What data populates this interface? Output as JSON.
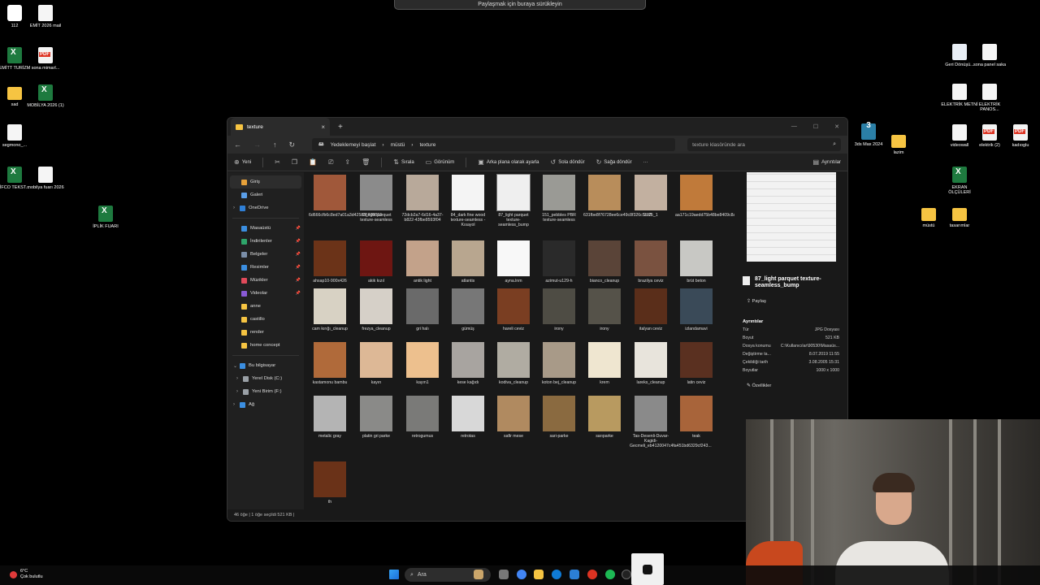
{
  "share_bar": "Paylaşmak için buraya sürükleyin",
  "desktop_left": [
    {
      "label": "112",
      "kind": "cube"
    },
    {
      "label": "EMİT 2026 mail",
      "kind": "doc"
    },
    {
      "label": "EMİTT TURİZM",
      "kind": "xls"
    },
    {
      "label": "sona mimarl...",
      "kind": "pdf"
    },
    {
      "label": "sad",
      "kind": "folder"
    },
    {
      "label": "MOBİLYA 2026 (1)",
      "kind": "xls"
    },
    {
      "label": "segmono_...",
      "kind": "doc"
    },
    {
      "label": "İFCO TEKST...",
      "kind": "xls"
    },
    {
      "label": "mobilya fuarı 2026",
      "kind": "doc"
    },
    {
      "label": "İPLİK FUARI",
      "kind": "xls"
    }
  ],
  "desktop_right": [
    {
      "label": "Geri Dönüşü...",
      "kind": "recycle"
    },
    {
      "label": "sona panel saka",
      "kind": "doc"
    },
    {
      "label": "ELEKTRİK METNİ",
      "kind": "doc"
    },
    {
      "label": "ELEKTRİK PANOS...",
      "kind": "doc"
    },
    {
      "label": "3ds Max 2024",
      "kind": "max"
    },
    {
      "label": "lazim",
      "kind": "folder"
    },
    {
      "label": "videowall",
      "kind": "doc"
    },
    {
      "label": "elektrik (2)",
      "kind": "pdf"
    },
    {
      "label": "kadıoglu",
      "kind": "pdf"
    },
    {
      "label": "EKRAN ÖLÇÜLERİ",
      "kind": "xls"
    },
    {
      "label": "müstü",
      "kind": "folder"
    },
    {
      "label": "tasarımlar",
      "kind": "folder"
    }
  ],
  "window": {
    "tab_title": "texture",
    "address": {
      "segments": [
        "Yedeklemeyi başlat",
        "müstü",
        "texture"
      ]
    },
    "search_placeholder": "texture klasöründe ara",
    "toolbar": {
      "new": "Yeni",
      "sort": "Sırala",
      "view": "Görünüm",
      "set_background": "Arka plana olarak ayarla",
      "rotate_left": "Sola döndür",
      "rotate_right": "Sağa döndür",
      "more": "···",
      "details": "Ayrıntılar"
    },
    "nav": {
      "top": [
        "Giriş",
        "Galeri",
        "OneDrive"
      ],
      "pinned": [
        "Masaüstü",
        "İndirilenler",
        "Belgeler",
        "Resimler",
        "Müzikler",
        "Videolar"
      ],
      "folders": [
        "anne",
        "castillo",
        "render",
        "home concept"
      ],
      "pc": [
        "Bu bilgisayar",
        "Yerel Disk (C:)",
        "Yeni Birim (F:)",
        "Ağ"
      ]
    },
    "files": [
      {
        "name": "6d666cfb6c8ed7a01a3d425c36409319",
        "color": "#a0583a"
      },
      {
        "name": "38_light parquet texture-seamless",
        "color": "#8b8b8b"
      },
      {
        "name": "72dcb2a7-6d16-4a37-b822-43fbe8593f04",
        "color": "#b8a99a"
      },
      {
        "name": "84_dark fine wood texture-seamless - Kısayol",
        "color": "#f4f4f4"
      },
      {
        "name": "87_light parquet texture-seamless_bump",
        "color": "#efefef"
      },
      {
        "name": "151_pebbles PBR texture-seamless",
        "color": "#9a9a95"
      },
      {
        "name": "631fbe8f76728ee6ce49c8f326c5cd3",
        "color": "#b88d5b"
      },
      {
        "name": "2175_1",
        "color": "#c2b0a0"
      },
      {
        "name": "aa171c19aedd75b48be8409c8a83eb1a",
        "color": "#c07a3a"
      },
      {
        "name": "ahsap10-900x426",
        "color": "#6b3318"
      },
      {
        "name": "akik kızıl",
        "color": "#6e1612"
      },
      {
        "name": "antik light",
        "color": "#c3a28a"
      },
      {
        "name": "atlantis",
        "color": "#b8a68f"
      },
      {
        "name": "ayna.lnm",
        "color": "#f8f8f8"
      },
      {
        "name": "azimut-u129-h",
        "color": "#2a2a2a"
      },
      {
        "name": "bianco_cleanup",
        "color": "#5a4438"
      },
      {
        "name": "brazilya ceviz",
        "color": "#7a5240"
      },
      {
        "name": "brüt beton",
        "color": "#c8c8c4"
      },
      {
        "name": "cam kırığı_cleanup",
        "color": "#d8d2c4"
      },
      {
        "name": "frezya_cleanup",
        "color": "#d6d0c8"
      },
      {
        "name": "gri halı",
        "color": "#6a6a6a"
      },
      {
        "name": "gümüş",
        "color": "#777"
      },
      {
        "name": "hareli ceviz",
        "color": "#7a3e22"
      },
      {
        "name": "irony",
        "color": "#4e4c44"
      },
      {
        "name": "irony",
        "color": "#555249"
      },
      {
        "name": "italyan ceviz",
        "color": "#5a2e1a"
      },
      {
        "name": "izlandamavi",
        "color": "#3a4a58"
      },
      {
        "name": "kastamonu bambu",
        "color": "#b06a3a"
      },
      {
        "name": "kayın",
        "color": "#ddb896"
      },
      {
        "name": "kayın1",
        "color": "#edc08e"
      },
      {
        "name": "kese kağıdı",
        "color": "#a8a4a0"
      },
      {
        "name": "kodiva_cleanup",
        "color": "#b0aca2"
      },
      {
        "name": "koton bej_cleanup",
        "color": "#a89a88"
      },
      {
        "name": "krem",
        "color": "#efe6d0"
      },
      {
        "name": "lareks_cleanup",
        "color": "#e8e4dc"
      },
      {
        "name": "latin ceviz",
        "color": "#5a3020"
      },
      {
        "name": "metalic gray",
        "color": "#b4b4b4"
      },
      {
        "name": "platin gri parke",
        "color": "#8a8a88"
      },
      {
        "name": "retrogumus",
        "color": "#7a7a78"
      },
      {
        "name": "retrotas",
        "color": "#d8d8d8"
      },
      {
        "name": "safir mese",
        "color": "#b08a60"
      },
      {
        "name": "sari-parke",
        "color": "#8a6a40"
      },
      {
        "name": "sarıparke",
        "color": "#b89a60"
      },
      {
        "name": "Tas-Desenli-Duvar-Kagidi-Gecmeli_eb4120047c4fa451bd6329cf243...",
        "color": "#8a8a8a"
      },
      {
        "name": "teak",
        "color": "#a8643a"
      },
      {
        "name": "th",
        "color": "#6a3218"
      }
    ],
    "preview": {
      "title": "87_light parquet texture-seamless_bump",
      "share": "Paylaş",
      "details_heading": "Ayrıntılar",
      "rows": [
        {
          "k": "Tür",
          "v": "JPG Dosyası"
        },
        {
          "k": "Boyut",
          "v": "521 KB"
        },
        {
          "k": "Dosya konumu",
          "v": "C:\\Kullanıcılar\\90530\\Masaüs..."
        },
        {
          "k": "Değiştirme ta...",
          "v": "8.07.2019 11:55"
        },
        {
          "k": "Çekildiği tarih",
          "v": "3.08.2005 15:31"
        },
        {
          "k": "Boyutlar",
          "v": "1000 x 1000"
        }
      ],
      "properties": "Özellikler"
    },
    "status": "46 öğe  |  1 öğe seçildi 521 KB  |"
  },
  "taskbar": {
    "weather_temp": "6°C",
    "weather_desc": "Çok bulutlu",
    "search": "Ara"
  }
}
